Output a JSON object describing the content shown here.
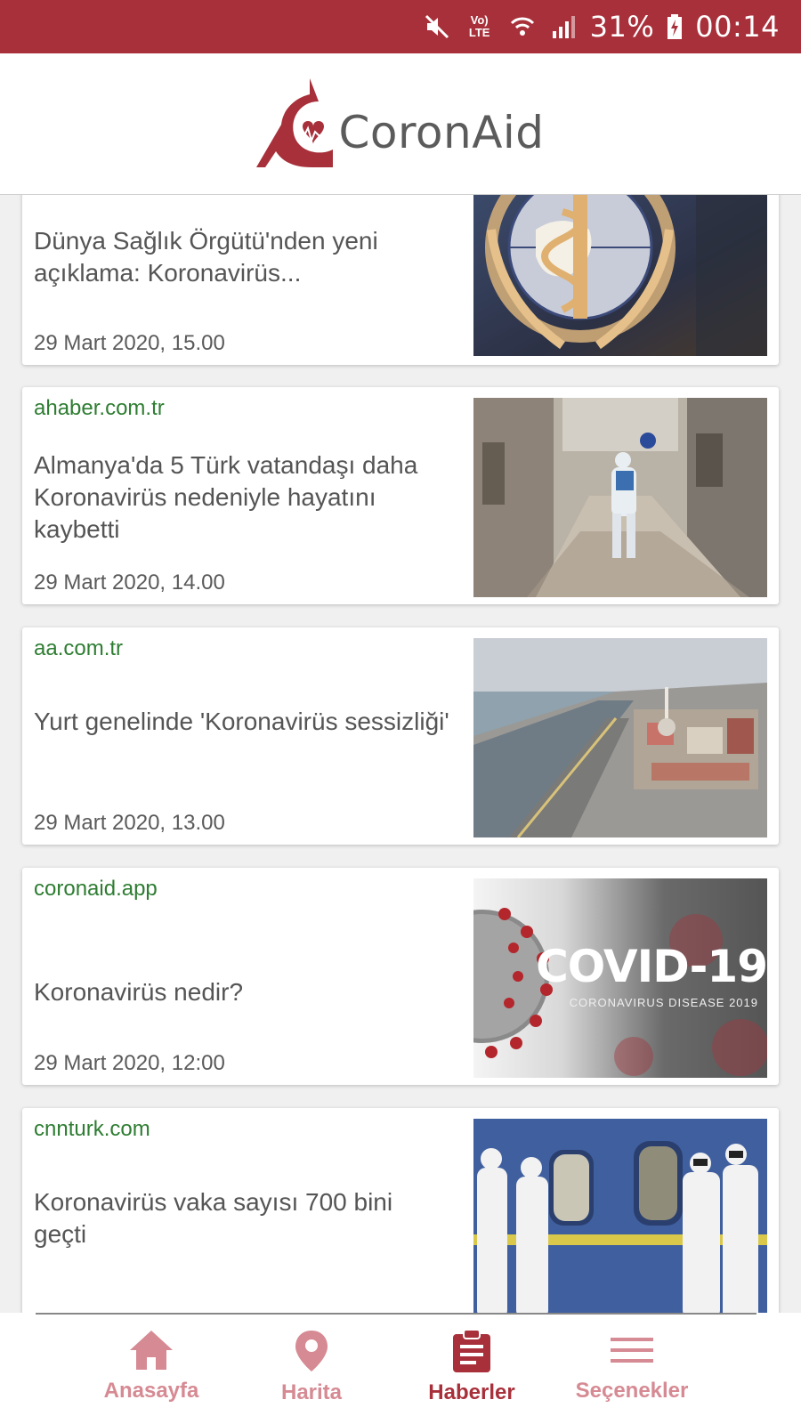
{
  "status_bar": {
    "battery": "31%",
    "time": "00:14",
    "icons": [
      "mute-icon",
      "volte-lte-icon",
      "wifi-icon",
      "signal-icon",
      "battery-charging-icon"
    ],
    "volte_label": "Vo)",
    "lte_label": "LTE"
  },
  "header": {
    "app_name": "CoronAid",
    "brand_color": "#a8303a"
  },
  "news": [
    {
      "source": "",
      "title": "Dünya Sağlık Örgütü'nden yeni açıklama: Koronavirüs...",
      "date": "29 Mart 2020, 15.00",
      "image": "who-emblem-image"
    },
    {
      "source": "ahaber.com.tr",
      "title": "Almanya'da 5 Türk vatandaşı daha Koronavirüs nedeniyle hayatını kaybetti",
      "date": "29 Mart 2020, 14.00",
      "image": "disinfection-worker-image"
    },
    {
      "source": "aa.com.tr",
      "title": "Yurt genelinde 'Koronavirüs sessizliği'",
      "date": "29 Mart 2020, 13.00",
      "image": "istanbul-aerial-image"
    },
    {
      "source": "coronaid.app",
      "title": "Koronavirüs nedir?",
      "date": "29 Mart 2020, 12:00",
      "image": "covid-19-image",
      "image_text": "COVID-19",
      "image_subtext": "CORONAVIRUS DISEASE 2019"
    },
    {
      "source": "cnnturk.com",
      "title": "Koronavirüs vaka sayısı 700 bini geçti",
      "date": "",
      "image": "train-hazmat-image"
    }
  ],
  "nav": {
    "items": [
      {
        "label": "Anasayfa",
        "icon": "home-icon"
      },
      {
        "label": "Harita",
        "icon": "map-pin-icon"
      },
      {
        "label": "Haberler",
        "icon": "clipboard-icon",
        "active": true
      },
      {
        "label": "Seçenekler",
        "icon": "menu-icon"
      }
    ],
    "active_color": "#a8303a",
    "inactive_color": "#d68a93"
  }
}
